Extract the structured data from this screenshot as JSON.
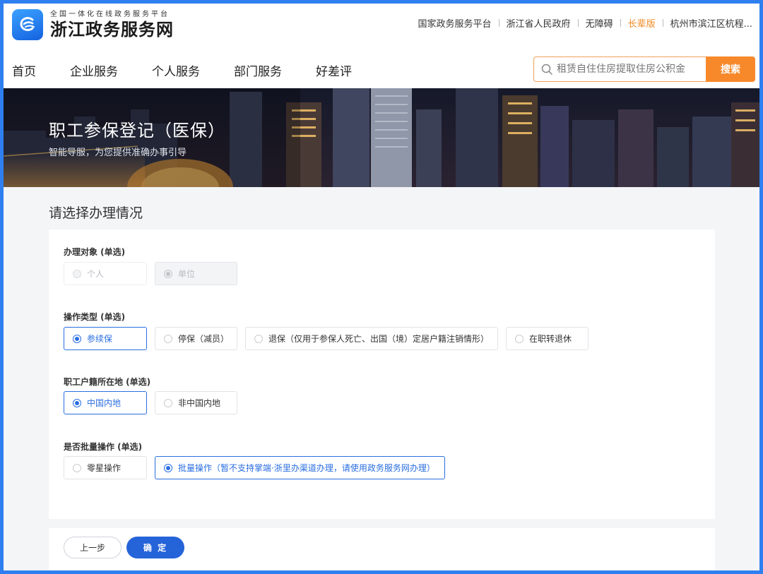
{
  "header": {
    "logo_subtitle": "全国一体化在线政务服务平台",
    "logo_title": "浙江政务服务网",
    "top_links": [
      "国家政务服务平台",
      "浙江省人民政府",
      "无障碍",
      "长辈版",
      "杭州市滨江区杭程..."
    ],
    "highlight_link_index": 3
  },
  "nav": {
    "items": [
      "首页",
      "企业服务",
      "个人服务",
      "部门服务",
      "好差评"
    ],
    "search_placeholder": "租赁自住住房提取住房公积金",
    "search_button": "搜索"
  },
  "banner": {
    "title": "职工参保登记（医保）",
    "subtitle": "智能导服，为您提供准确办事引导"
  },
  "main": {
    "section_title": "请选择办理情况",
    "groups": [
      {
        "label": "办理对象 (单选)",
        "options": [
          {
            "label": "个人",
            "state": "disabled"
          },
          {
            "label": "单位",
            "state": "disabled-selected"
          }
        ]
      },
      {
        "label": "操作类型 (单选)",
        "options": [
          {
            "label": "参续保",
            "state": "selected"
          },
          {
            "label": "停保（减员）",
            "state": "normal"
          },
          {
            "label": "退保（仅用于参保人死亡、出国（境）定居户籍注销情形）",
            "state": "normal"
          },
          {
            "label": "在职转退休",
            "state": "normal"
          }
        ]
      },
      {
        "label": "职工户籍所在地 (单选)",
        "options": [
          {
            "label": "中国内地",
            "state": "selected"
          },
          {
            "label": "非中国内地",
            "state": "normal"
          }
        ]
      },
      {
        "label": "是否批量操作 (单选)",
        "options": [
          {
            "label": "零星操作",
            "state": "normal"
          },
          {
            "label": "批量操作（暂不支持掌端·浙里办渠道办理，请使用政务服务网办理）",
            "state": "selected"
          }
        ]
      }
    ]
  },
  "footer": {
    "prev_button": "上一步",
    "confirm_button": "确 定"
  },
  "colors": {
    "accent": "#2563d9",
    "search_orange": "#f7892b",
    "frame_blue": "#2f7ff0",
    "highlight_orange": "#f08a24"
  }
}
